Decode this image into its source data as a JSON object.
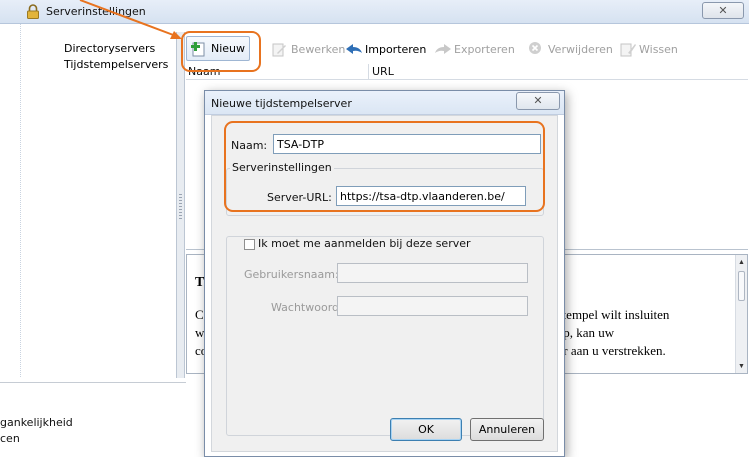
{
  "window": {
    "title": "Serverinstellingen",
    "close_glyph": "✕"
  },
  "nav": {
    "items": [
      {
        "label": "Directoryservers"
      },
      {
        "label": "Tijdstempelservers"
      }
    ]
  },
  "toolbar": {
    "new_label": "Nieuw",
    "edit_label": "Bewerken",
    "import_label": "Importeren",
    "export_label": "Exporteren",
    "delete_label": "Verwijderen",
    "clear_label": "Wissen"
  },
  "list": {
    "columns": [
      "Naam",
      "URL"
    ]
  },
  "info": {
    "heading_partial": "Ti",
    "left_fragments": [
      "Co",
      "wa",
      "co"
    ],
    "right_fragments": [
      "dstempel wilt insluiten",
      "oep, kan uw",
      "ver aan u verstrekken."
    ]
  },
  "bottom": {
    "fragments": [
      "gankelijkheid",
      "cen"
    ]
  },
  "dialog": {
    "title": "Nieuwe tijdstempelserver",
    "close_glyph": "✕",
    "name_label": "Naam:",
    "name_value": "TSA-DTP",
    "settings_group_label": "Serverinstellingen",
    "server_url_label": "Server-URL:",
    "server_url_value": "https://tsa-dtp.vlaanderen.be/",
    "login_checkbox_label": "Ik moet me aanmelden bij deze server",
    "username_label": "Gebruikersnaam:",
    "password_label": "Wachtwoord:",
    "ok_label": "OK",
    "cancel_label": "Annuleren"
  },
  "colors": {
    "annotation": "#e8731f",
    "accent_blue": "#3c7fb1"
  }
}
